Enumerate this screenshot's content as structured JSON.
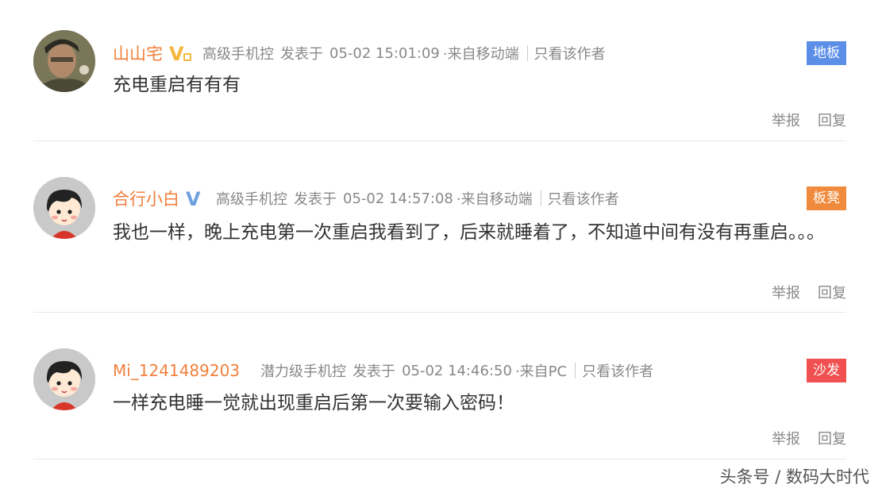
{
  "posts": [
    {
      "username": "山山宅",
      "badge_icon": "v-vip-icon",
      "level": "高级手机控",
      "posted_label": "发表于",
      "time": "05-02 15:01:09",
      "source": "·来自移动端",
      "only_author": "只看该作者",
      "floor": "地板",
      "floor_color": "#5b8ee6",
      "content": "充电重启有有有",
      "report": "举报",
      "reply": "回复"
    },
    {
      "username": "合行小白",
      "badge_icon": "v-verified-icon",
      "level": "高级手机控",
      "posted_label": "发表于",
      "time": "05-02 14:57:08",
      "source": "·来自移动端",
      "only_author": "只看该作者",
      "floor": "板凳",
      "floor_color": "#f08a3c",
      "content": "我也一样，晚上充电第一次重启我看到了，后来就睡着了，不知道中间有没有再重启。。。",
      "report": "举报",
      "reply": "回复"
    },
    {
      "username": "Mi_1241489203",
      "level": "潜力级手机控",
      "posted_label": "发表于",
      "time": "05-02 14:46:50",
      "source": "·来自PC",
      "only_author": "只看该作者",
      "floor": "沙发",
      "floor_color": "#f05050",
      "content": "一样充电睡一觉就出现重启后第一次要输入密码！",
      "report": "举报",
      "reply": "回复"
    }
  ],
  "watermark": "头条号 / 数码大时代",
  "colors": {
    "username": "#f07f3c",
    "meta_text": "#888888",
    "divider": "#e8e8e8"
  }
}
